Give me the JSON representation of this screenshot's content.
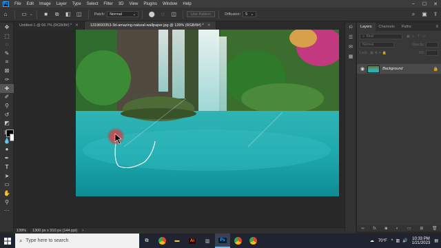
{
  "app": {
    "logo": "Ps",
    "menu": [
      "File",
      "Edit",
      "Image",
      "Layer",
      "Type",
      "Select",
      "Filter",
      "3D",
      "View",
      "Plugins",
      "Window",
      "Help"
    ]
  },
  "options": {
    "patch_label": "Patch:",
    "patch_value": "Normal",
    "use_pattern_label": "Use Pattern",
    "diffusion_label": "Diffusion:",
    "diffusion_value": "5"
  },
  "tabs": [
    {
      "label": "Untitled-1 @ 66.7% (RGB/8#) *",
      "active": false
    },
    {
      "label": "1319693353-3d-amazing-natural-wallpaper.jpg @ 139% (RGB/8#) *",
      "active": true
    }
  ],
  "status": {
    "zoom": "139%",
    "doc_size": "1300 px x 910 px (144 ppi)"
  },
  "layers_panel": {
    "tabs": [
      "Layers",
      "Channels",
      "Paths"
    ],
    "filter_placeholder": "Kind",
    "blend_mode": "Normal",
    "opacity_label": "Opacity:",
    "lock_label": "Lock:",
    "fill_label": "Fill:",
    "layer_name": "Background"
  },
  "taskbar": {
    "search_placeholder": "Type here to search",
    "weather": "70°F",
    "time": "10:33 PM",
    "date": "1/21/2023"
  }
}
